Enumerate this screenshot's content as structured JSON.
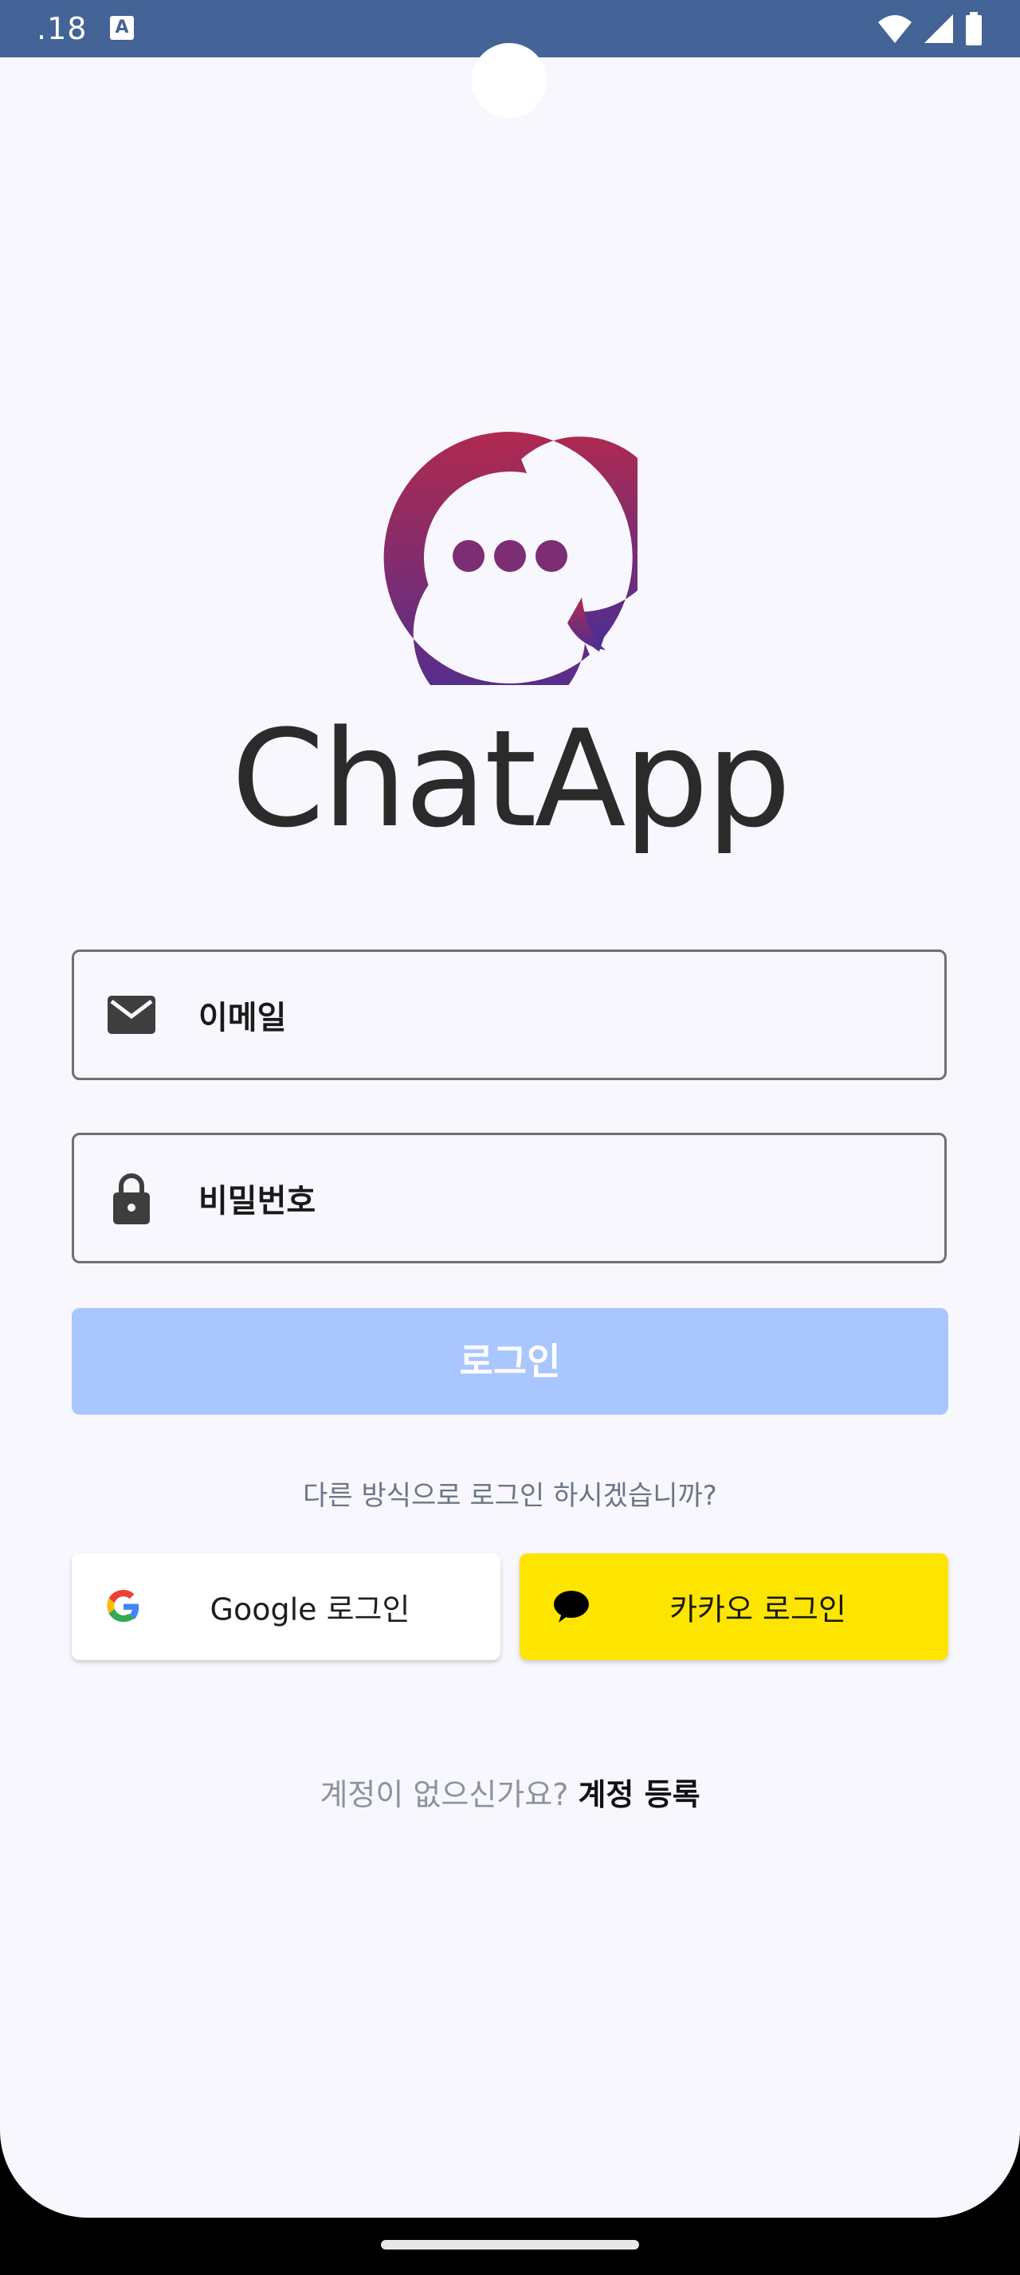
{
  "status_bar": {
    "time": ".18",
    "notification_letter": "A",
    "icons": [
      "wifi-icon",
      "signal-icon",
      "battery-icon"
    ]
  },
  "app": {
    "name": "ChatApp",
    "logo": "chat-bubble-logo"
  },
  "form": {
    "email_label": "이메일",
    "password_label": "비밀번호",
    "login_button": "로그인"
  },
  "alt_login": {
    "prompt": "다른 방식으로 로그인 하시겠습니까?",
    "google_label": "Google 로그인",
    "kakao_label": "카카오 로그인"
  },
  "signup": {
    "prompt": "계정이 없으신가요?",
    "link": "계정 등록"
  },
  "colors": {
    "status_bar": "#446396",
    "background": "#f8f7fd",
    "login_button": "#a9c6ff",
    "kakao": "#fee500",
    "logo_gradient_top": "#b02a4f",
    "logo_gradient_bottom": "#4a2f94"
  }
}
